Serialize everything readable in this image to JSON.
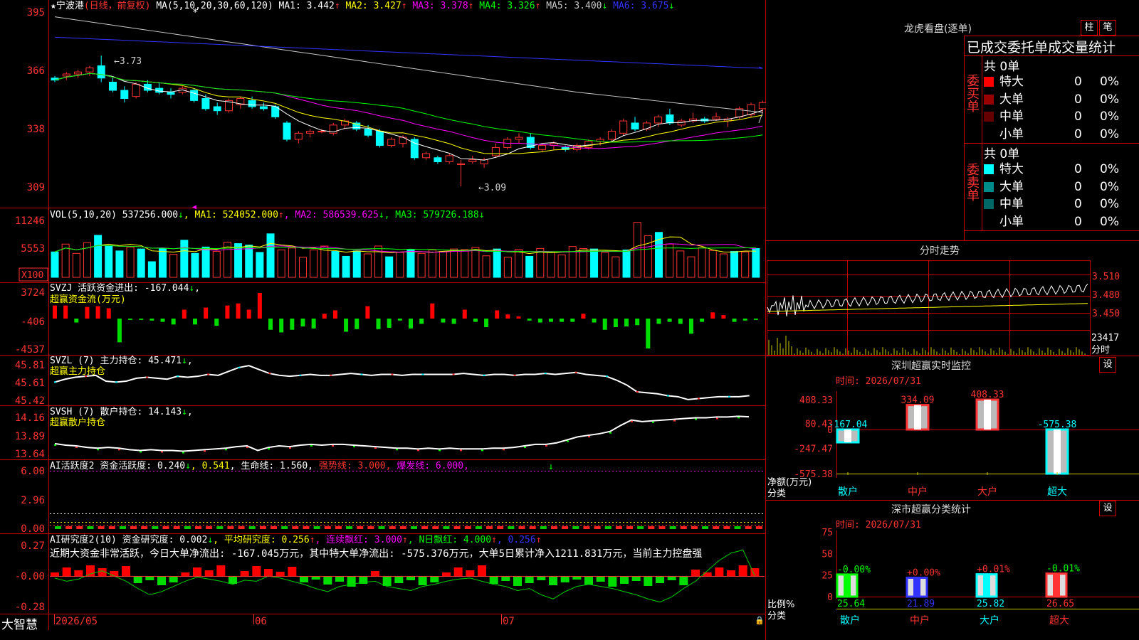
{
  "stock": {
    "name": "★宁波港",
    "mode": "(日线，前复权)",
    "ma_params": "MA(5,10,20,30,60,120)",
    "ma": [
      {
        "label": "MA1: 3.442",
        "arrow": "↑",
        "color": "#ffffff"
      },
      {
        "label": "MA2: 3.427",
        "arrow": "↑",
        "color": "#ffff00"
      },
      {
        "label": "MA3: 3.378",
        "arrow": "↑",
        "color": "#ff00ff"
      },
      {
        "label": "MA4: 3.326",
        "arrow": "↑",
        "color": "#00ff00"
      },
      {
        "label": "MA5: 3.400",
        "arrow": "↓",
        "color": "#c8c8c8"
      },
      {
        "label": "MA6: 3.675",
        "arrow": "↓",
        "color": "#3333ff"
      }
    ],
    "high_label": "3.73",
    "low_label": "3.09",
    "axis": [
      "395",
      "366",
      "338",
      "309"
    ]
  },
  "vol": {
    "title": "VOL(5,10,20)",
    "value": "537256.000",
    "ma": [
      {
        "label": "MA1: 524052.000",
        "arrow": "↑",
        "color": "#ffff00"
      },
      {
        "label": "MA2: 586539.625",
        "arrow": "↓",
        "color": "#ff00ff"
      },
      {
        "label": "MA3: 579726.188",
        "arrow": "↓",
        "color": "#00ff00"
      }
    ],
    "axis": [
      "11246",
      "5553"
    ],
    "unit": "X100"
  },
  "svzj": {
    "title": "SVZJ  活跃资金进出: -167.044",
    "arrow": "↓",
    "sub": "超赢资金流(万元)",
    "axis": [
      "3724",
      "-406",
      "-4537"
    ]
  },
  "svzl": {
    "title": "SVZL (7) 主力持仓: 45.471",
    "arrow": "↓",
    "tail": ",",
    "sub": "超赢主力持仓",
    "axis": [
      "45.81",
      "45.61",
      "45.42"
    ]
  },
  "svsh": {
    "title": "SVSH (7) 散户持仓: 14.143",
    "arrow": "↓",
    "tail": ",",
    "sub": "超赢散户持仓",
    "axis": [
      "14.16",
      "13.89",
      "13.64"
    ]
  },
  "ai2": {
    "parts": [
      {
        "t": "AI活跃度2 资金活跃度: 0.240",
        "c": "#ffffff"
      },
      {
        "t": "↓",
        "c": "#00ff00"
      },
      {
        "t": ", 0.541",
        "c": "#ffff00"
      },
      {
        "t": ", 生命线: 1.560,",
        "c": "#ffffff"
      },
      {
        "t": " 强势线: 3.000,",
        "c": "#ff3333"
      },
      {
        "t": " 爆发线: 6.000,",
        "c": "#ff00ff"
      }
    ],
    "axis": [
      "6.00",
      "2.96",
      "0.00"
    ]
  },
  "ai_research": {
    "parts": [
      {
        "t": "AI研究度2(10) 资金研究度: 0.002",
        "c": "#ffffff"
      },
      {
        "t": "↓",
        "c": "#00ff00"
      },
      {
        "t": ", 平均研究度: 0.256",
        "c": "#ffff00"
      },
      {
        "t": "↑",
        "c": "#ff3333"
      },
      {
        "t": ", 连续飘红: 3.000",
        "c": "#ff00ff"
      },
      {
        "t": "↑",
        "c": "#ff3333"
      },
      {
        "t": ", N日飘红: 4.000",
        "c": "#00ff00"
      },
      {
        "t": "↑",
        "c": "#ff3333"
      },
      {
        "t": ", 0.256",
        "c": "#3333ff"
      },
      {
        "t": "↑",
        "c": "#ff3333"
      }
    ],
    "summary": "近期大资金非常活跃，今日大单净流出: -167.045万元，其中特大单净流出: -575.376万元，大单5日累计净入1211.831万元，当前主力控盘强",
    "axis": [
      "0.27",
      "-0.00",
      "-0.28"
    ]
  },
  "bottom": {
    "brand": "大智慧",
    "dates": [
      "2026/05",
      "06",
      "07"
    ]
  },
  "longhu": {
    "title": "龙虎看盘(逐单)",
    "btn1": "柱",
    "btn2": "笔",
    "header": "已成交委托单成交量统计",
    "buy_label": "委买单",
    "sell_label": "委卖单",
    "buy_total": "共 0单",
    "sell_total": "共 0单",
    "buy_rows": [
      {
        "name": "特大",
        "val": "0",
        "pct": "0%",
        "color": "#ff0000"
      },
      {
        "name": "大单",
        "val": "0",
        "pct": "0%",
        "color": "#990000"
      },
      {
        "name": "中单",
        "val": "0",
        "pct": "0%",
        "color": "#660000"
      },
      {
        "name": "小单",
        "val": "0",
        "pct": "0%",
        "color": "#000000"
      }
    ],
    "sell_rows": [
      {
        "name": "特大",
        "val": "0",
        "pct": "0%",
        "color": "#00ffff"
      },
      {
        "name": "大单",
        "val": "0",
        "pct": "0%",
        "color": "#008b8b"
      },
      {
        "name": "中单",
        "val": "0",
        "pct": "0%",
        "color": "#006666"
      },
      {
        "name": "小单",
        "val": "0",
        "pct": "0%",
        "color": "#000000"
      }
    ]
  },
  "intraday": {
    "title": "分时走势",
    "axis": [
      "3.510",
      "3.480",
      "3.450"
    ],
    "vol_label": "23417",
    "unit": "分时"
  },
  "monitor": {
    "title": "深圳超赢实时监控",
    "btn": "设",
    "time": "时间: 2026/07/31",
    "axis": [
      "408.33",
      "80.43",
      "0",
      "-247.47",
      "-575.38"
    ],
    "y_label": "净额(万元)",
    "x_label": "分类",
    "bars": [
      {
        "cat": "散户",
        "value": -167.04,
        "label": "-167.04",
        "color": "#00ffff"
      },
      {
        "cat": "中户",
        "value": 334.09,
        "label": "334.09",
        "color": "#ff3333"
      },
      {
        "cat": "大户",
        "value": 408.33,
        "label": "408.33",
        "color": "#ff3333"
      },
      {
        "cat": "超大",
        "value": -575.38,
        "label": "-575.38",
        "color": "#00ffff"
      }
    ]
  },
  "classify": {
    "title": "深市超赢分类统计",
    "btn": "设",
    "time": "时间: 2026/07/31",
    "axis": [
      "75",
      "50",
      "25",
      "0"
    ],
    "y_label": "比例%",
    "x_label": "分类",
    "bars": [
      {
        "cat": "散户",
        "value": 25.64,
        "label": "25.64",
        "delta": "-0.00%",
        "color": "#00ff00"
      },
      {
        "cat": "中户",
        "value": 21.89,
        "label": "21.89",
        "delta": "+0.00%",
        "color": "#3333ff"
      },
      {
        "cat": "大户",
        "value": 25.82,
        "label": "25.82",
        "delta": "+0.01%",
        "color": "#00ffff"
      },
      {
        "cat": "超大",
        "value": 26.65,
        "label": "26.65",
        "delta": "-0.01%",
        "color": "#ff3333"
      }
    ]
  },
  "chart_data": [
    {
      "type": "candlestick",
      "title": "宁波港 (日线，前复权)",
      "ylim": [
        3.05,
        3.98
      ],
      "ohlc": [
        [
          3.62,
          3.63,
          3.6,
          3.61
        ],
        [
          3.63,
          3.65,
          3.61,
          3.64
        ],
        [
          3.64,
          3.66,
          3.62,
          3.65
        ],
        [
          3.65,
          3.68,
          3.63,
          3.67
        ],
        [
          3.68,
          3.73,
          3.6,
          3.62
        ],
        [
          3.6,
          3.62,
          3.55,
          3.56
        ],
        [
          3.56,
          3.58,
          3.5,
          3.52
        ],
        [
          3.53,
          3.6,
          3.52,
          3.59
        ],
        [
          3.59,
          3.61,
          3.55,
          3.56
        ],
        [
          3.57,
          3.6,
          3.54,
          3.55
        ],
        [
          3.55,
          3.57,
          3.52,
          3.54
        ],
        [
          3.55,
          3.58,
          3.54,
          3.57
        ],
        [
          3.56,
          3.57,
          3.5,
          3.51
        ],
        [
          3.52,
          3.54,
          3.46,
          3.47
        ],
        [
          3.48,
          3.5,
          3.44,
          3.46
        ],
        [
          3.46,
          3.52,
          3.45,
          3.51
        ],
        [
          3.49,
          3.53,
          3.47,
          3.52
        ],
        [
          3.51,
          3.53,
          3.47,
          3.48
        ],
        [
          3.48,
          3.5,
          3.46,
          3.47
        ],
        [
          3.48,
          3.49,
          3.42,
          3.43
        ],
        [
          3.4,
          3.41,
          3.31,
          3.32
        ],
        [
          3.32,
          3.36,
          3.3,
          3.35
        ],
        [
          3.35,
          3.37,
          3.33,
          3.36
        ],
        [
          3.36,
          3.37,
          3.35,
          3.36
        ],
        [
          3.35,
          3.4,
          3.34,
          3.39
        ],
        [
          3.39,
          3.42,
          3.37,
          3.41
        ],
        [
          3.4,
          3.41,
          3.36,
          3.37
        ],
        [
          3.37,
          3.39,
          3.33,
          3.34
        ],
        [
          3.36,
          3.37,
          3.28,
          3.29
        ],
        [
          3.29,
          3.33,
          3.28,
          3.32
        ],
        [
          3.3,
          3.34,
          3.28,
          3.33
        ],
        [
          3.32,
          3.33,
          3.22,
          3.23
        ],
        [
          3.23,
          3.26,
          3.22,
          3.25
        ],
        [
          3.23,
          3.24,
          3.2,
          3.21
        ],
        [
          3.21,
          3.25,
          3.2,
          3.24
        ],
        [
          3.2,
          3.22,
          3.09,
          3.2
        ],
        [
          3.21,
          3.24,
          3.2,
          3.22
        ],
        [
          3.2,
          3.23,
          3.18,
          3.22
        ],
        [
          3.24,
          3.3,
          3.23,
          3.28
        ],
        [
          3.28,
          3.33,
          3.27,
          3.32
        ],
        [
          3.32,
          3.35,
          3.3,
          3.33
        ],
        [
          3.33,
          3.35,
          3.27,
          3.28
        ],
        [
          3.27,
          3.3,
          3.26,
          3.29
        ],
        [
          3.29,
          3.31,
          3.27,
          3.3
        ],
        [
          3.28,
          3.29,
          3.26,
          3.27
        ],
        [
          3.27,
          3.3,
          3.26,
          3.29
        ],
        [
          3.28,
          3.32,
          3.27,
          3.31
        ],
        [
          3.31,
          3.33,
          3.29,
          3.32
        ],
        [
          3.32,
          3.37,
          3.31,
          3.36
        ],
        [
          3.35,
          3.42,
          3.34,
          3.41
        ],
        [
          3.4,
          3.43,
          3.36,
          3.37
        ],
        [
          3.37,
          3.41,
          3.36,
          3.4
        ],
        [
          3.4,
          3.44,
          3.38,
          3.43
        ],
        [
          3.44,
          3.47,
          3.39,
          3.4
        ],
        [
          3.39,
          3.42,
          3.38,
          3.41
        ],
        [
          3.41,
          3.45,
          3.4,
          3.42
        ],
        [
          3.42,
          3.43,
          3.4,
          3.41
        ],
        [
          3.42,
          3.45,
          3.41,
          3.43
        ],
        [
          3.41,
          3.43,
          3.38,
          3.42
        ],
        [
          3.43,
          3.48,
          3.42,
          3.47
        ],
        [
          3.44,
          3.5,
          3.43,
          3.49
        ],
        [
          3.47,
          3.51,
          3.45,
          3.5
        ]
      ]
    },
    {
      "type": "bar",
      "title": "VOL(5,10,20)",
      "ylim": [
        0,
        12800
      ],
      "values": [
        5200,
        6800,
        4900,
        7100,
        8600,
        6500,
        5400,
        6200,
        5800,
        3200,
        5900,
        4700,
        7600,
        4900,
        6200,
        5300,
        7200,
        6900,
        6600,
        5100,
        8900,
        5600,
        6000,
        4100,
        5600,
        6400,
        5300,
        4300,
        5400,
        4800,
        6400,
        4200,
        5100,
        5700,
        4900,
        5600,
        5300,
        5800,
        5700,
        6100,
        4400,
        5800,
        4100,
        5700,
        4300,
        5900,
        5200,
        4600,
        6300,
        5900,
        5800,
        5100,
        4200,
        5600,
        11246,
        8500,
        9200,
        6800,
        5400,
        4200,
        6100,
        5500,
        4800,
        5300,
        5200,
        5900
      ]
    },
    {
      "type": "bar",
      "title": "SVZJ 活跃资金进出",
      "ylim": [
        -4537,
        3724
      ],
      "values": [
        1900,
        1900,
        -600,
        1700,
        1800,
        1500,
        -3600,
        -200,
        -200,
        -300,
        -500,
        -900,
        1300,
        -900,
        1600,
        -1100,
        1900,
        2200,
        1300,
        3724,
        -1700,
        -2100,
        -1700,
        -1200,
        -1500,
        700,
        1200,
        -2000,
        -1600,
        1800,
        -1600,
        -1400,
        -300,
        -1500,
        -800,
        2200,
        -600,
        -800,
        1300,
        -500,
        -1300,
        1200,
        600,
        300,
        -300,
        -600,
        -500,
        -500,
        -500,
        700,
        -600,
        -1700,
        -1300,
        -1200,
        -1000,
        -4537,
        -800,
        -500,
        -800,
        -2300,
        -500,
        900,
        500,
        -500,
        -300,
        -200
      ]
    },
    {
      "type": "line",
      "title": "SVZL (7) 主力持仓",
      "ylim": [
        45.4,
        45.84
      ],
      "values": [
        45.61,
        45.64,
        45.66,
        45.67,
        45.68,
        45.62,
        45.61,
        45.62,
        45.65,
        45.66,
        45.65,
        45.64,
        45.67,
        45.66,
        45.67,
        45.69,
        45.68,
        45.72,
        45.76,
        45.78,
        45.74,
        45.7,
        45.68,
        45.67,
        45.68,
        45.69,
        45.68,
        45.68,
        45.69,
        45.7,
        45.69,
        45.68,
        45.69,
        45.69,
        45.68,
        45.69,
        45.69,
        45.69,
        45.69,
        45.69,
        45.7,
        45.69,
        45.68,
        45.69,
        45.69,
        45.68,
        45.69,
        45.69,
        45.7,
        45.69,
        45.7,
        45.71,
        45.69,
        45.68,
        45.67,
        45.63,
        45.58,
        45.51,
        45.5,
        45.49,
        45.47,
        45.46,
        45.43,
        45.44,
        45.45,
        45.46,
        45.46,
        45.46,
        45.471
      ]
    },
    {
      "type": "line",
      "title": "SVSH (7) 散户持仓",
      "ylim": [
        13.62,
        14.2
      ],
      "values": [
        13.79,
        13.77,
        13.76,
        13.74,
        13.73,
        13.74,
        13.73,
        13.71,
        13.7,
        13.71,
        13.7,
        13.7,
        13.69,
        13.7,
        13.71,
        13.72,
        13.73,
        13.75,
        13.76,
        13.7,
        13.74,
        13.76,
        13.75,
        13.77,
        13.78,
        13.77,
        13.78,
        13.78,
        13.77,
        13.76,
        13.75,
        13.74,
        13.73,
        13.73,
        13.72,
        13.73,
        13.72,
        13.73,
        13.72,
        13.72,
        13.72,
        13.73,
        13.73,
        13.74,
        13.76,
        13.78,
        13.78,
        13.8,
        13.84,
        13.88,
        13.9,
        13.92,
        13.95,
        14.03,
        14.1,
        14.08,
        14.09,
        14.1,
        14.11,
        14.12,
        14.13,
        14.13,
        14.14,
        14.14,
        14.15,
        14.143
      ]
    },
    {
      "type": "line",
      "title": "AI研究度2(10)",
      "ylim": [
        -0.3,
        0.3
      ],
      "values": [
        -0.02,
        -0.05,
        -0.03,
        0.02,
        0.05,
        0.0,
        -0.05,
        -0.12,
        -0.18,
        -0.15,
        -0.1,
        -0.05,
        -0.01,
        -0.03,
        -0.05,
        -0.08,
        -0.04,
        -0.05,
        0.0,
        -0.02,
        -0.05,
        -0.08,
        -0.12,
        -0.15,
        -0.1,
        -0.08,
        -0.06,
        -0.05,
        -0.1,
        -0.12,
        -0.14,
        -0.1,
        -0.08,
        -0.05,
        -0.03,
        -0.02,
        -0.05,
        -0.08,
        -0.1,
        -0.14,
        -0.12,
        -0.18,
        -0.22,
        -0.15,
        -0.1,
        -0.08,
        -0.1,
        -0.12,
        -0.15,
        -0.18,
        -0.22,
        -0.25,
        -0.2,
        -0.12,
        -0.05,
        0.05,
        0.15,
        0.22,
        0.25,
        0.002
      ]
    }
  ]
}
